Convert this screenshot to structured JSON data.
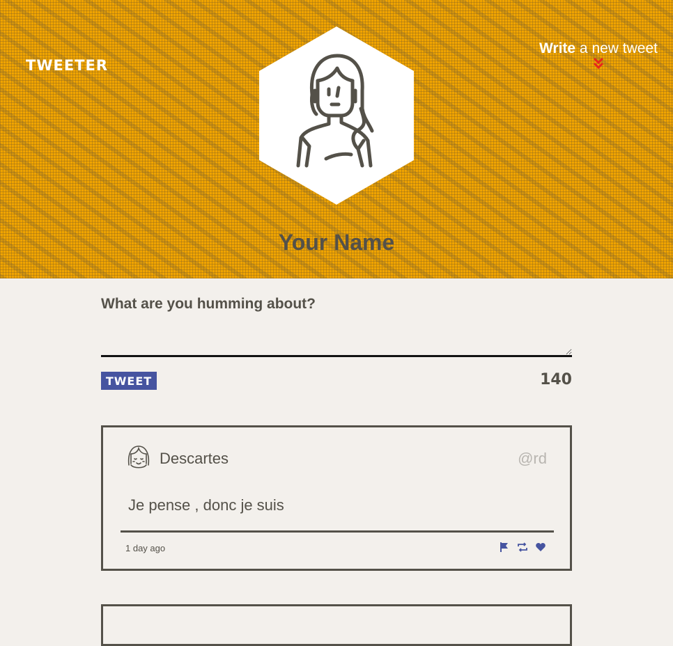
{
  "header": {
    "brand": "TWEETER",
    "compose_toggle": {
      "strong": "Write",
      "rest": " a new tweet"
    },
    "profile_name": "Your Name"
  },
  "compose": {
    "label": "What are you humming about?",
    "input_value": "",
    "button_label": "TWEET",
    "counter": "140"
  },
  "tweets": [
    {
      "author": "Descartes",
      "handle": "@rd",
      "text": "Je pense , donc je suis",
      "time": "1 day ago",
      "actions": [
        "flag-icon",
        "retweet-icon",
        "heart-icon"
      ]
    }
  ],
  "colors": {
    "header_bg": "#f0a400",
    "accent": "#4654a0",
    "arrow": "#e8261b",
    "text": "#545149",
    "page_bg": "#f3f0ec"
  }
}
